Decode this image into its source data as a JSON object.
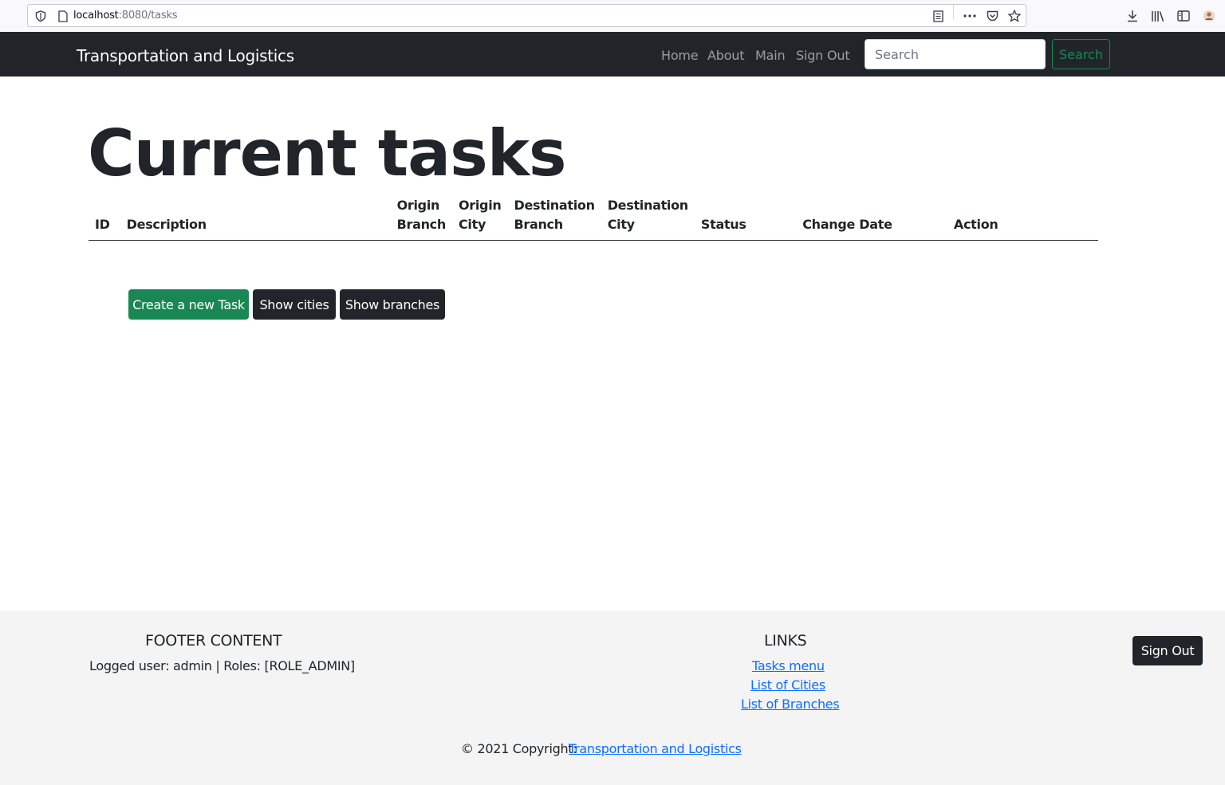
{
  "browser": {
    "url_host": "localhost",
    "url_rest": ":8080/tasks"
  },
  "navbar": {
    "brand": "Transportation and Logistics",
    "links": [
      "Home",
      "About",
      "Main",
      "Sign Out"
    ],
    "search_placeholder": "Search",
    "search_button": "Search"
  },
  "main": {
    "title": "Current tasks",
    "table": {
      "headers": [
        {
          "line1": "",
          "line2": "ID"
        },
        {
          "line1": "",
          "line2": "Description"
        },
        {
          "line1": "Origin",
          "line2": "Branch"
        },
        {
          "line1": "Origin",
          "line2": "City"
        },
        {
          "line1": "Destination",
          "line2": "Branch"
        },
        {
          "line1": "Destination",
          "line2": "City"
        },
        {
          "line1": "",
          "line2": "Status"
        },
        {
          "line1": "",
          "line2": "Change Date"
        },
        {
          "line1": "",
          "line2": "Action"
        }
      ],
      "rows": []
    },
    "buttons": {
      "create": "Create a new Task",
      "cities": "Show cities",
      "branches": "Show branches"
    }
  },
  "footer": {
    "content_heading": "FOOTER CONTENT",
    "logged_user": "Logged user: admin | Roles: [ROLE_ADMIN]",
    "links_heading": "LINKS",
    "links": [
      "Tasks menu",
      "List of Cities",
      "List of Branches"
    ],
    "copyright_prefix": "© 2021 Copyright: ",
    "copyright_link": "Transportation and Logistics",
    "sign_out": "Sign Out"
  },
  "colors": {
    "navbar_bg": "#212529",
    "success": "#198754",
    "link": "#0d6efd",
    "footer_bg": "#f4f4f4"
  }
}
